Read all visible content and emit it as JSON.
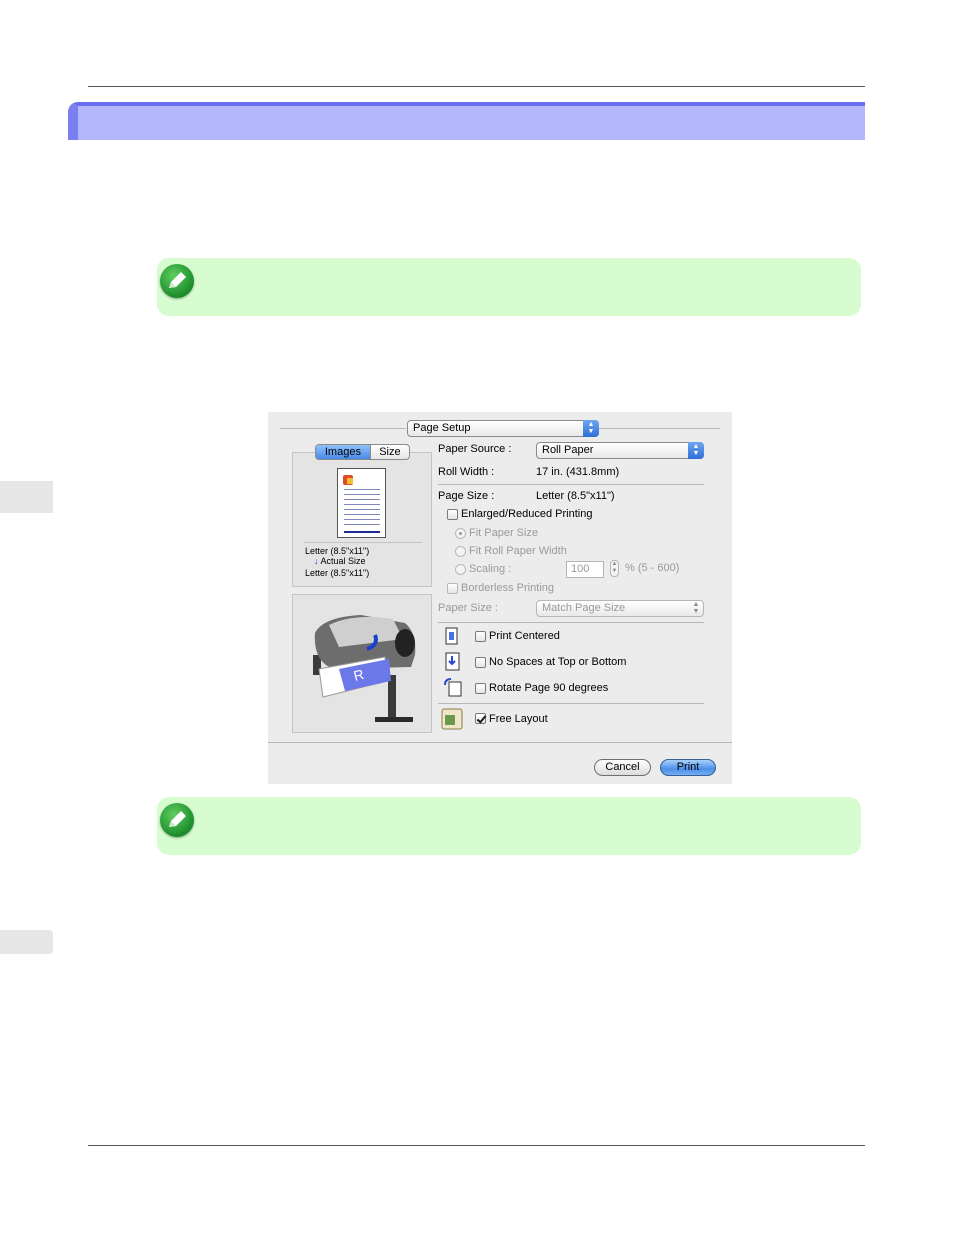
{
  "dialog": {
    "title_popup": "Page Setup",
    "tabs": [
      "Images",
      "Size"
    ],
    "active_tab": "Images",
    "preview": {
      "from_size": "Letter (8.5\"x11\")",
      "arrow_label": "Actual Size",
      "to_size": "Letter (8.5\"x11\")"
    },
    "paper_source_label": "Paper Source :",
    "paper_source_value": "Roll Paper",
    "roll_width_label": "Roll Width :",
    "roll_width_value": "17 in. (431.8mm)",
    "page_size_label": "Page Size :",
    "page_size_value": "Letter (8.5\"x11\")",
    "enlarged_reduced": "Enlarged/Reduced Printing",
    "fit_paper_size": "Fit Paper Size",
    "fit_roll_width": "Fit Roll Paper Width",
    "scaling_label": "Scaling :",
    "scaling_value": "100",
    "scaling_range": "% (5 - 600)",
    "borderless": "Borderless Printing",
    "paper_size_label": "Paper Size :",
    "paper_size_value": "Match Page Size",
    "print_centered": "Print Centered",
    "no_spaces": "No Spaces at Top or Bottom",
    "rotate_page": "Rotate Page 90 degrees",
    "free_layout": "Free Layout",
    "free_layout_checked": true,
    "cancel_button": "Cancel",
    "print_button": "Print"
  },
  "colors": {
    "heading_bar": "#b3b6fb",
    "heading_accent": "#6a6ff0",
    "note_bg": "#d6fcd0",
    "dialog_bg": "#ececec"
  }
}
